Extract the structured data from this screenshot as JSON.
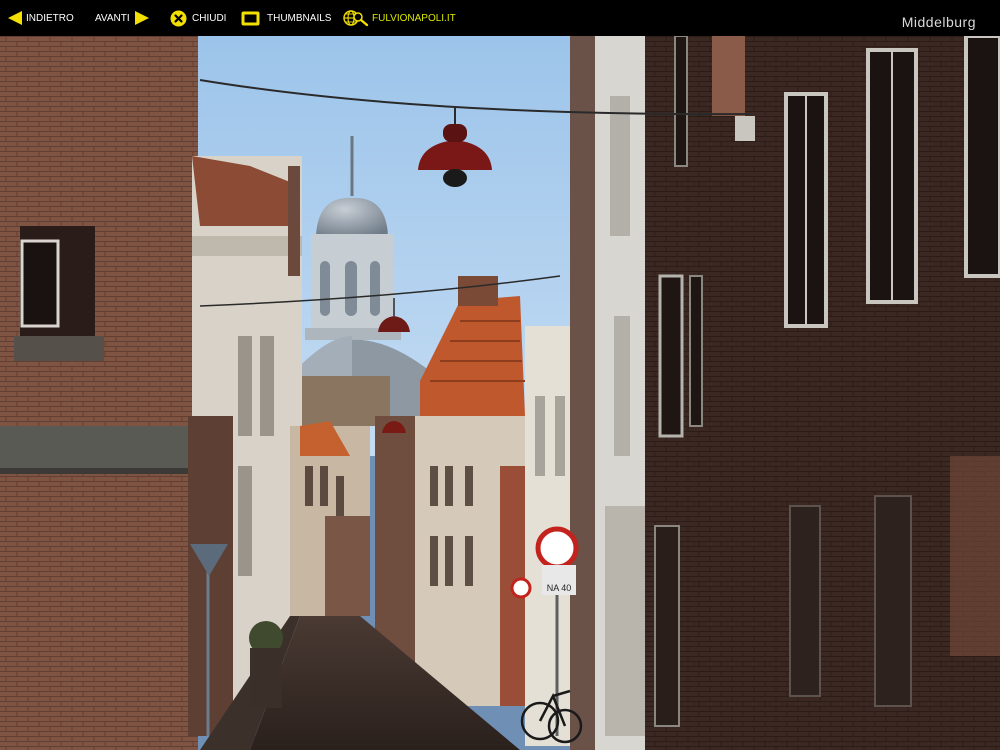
{
  "toolbar": {
    "prev_label": "INDIETRO",
    "next_label": "AVANTI",
    "close_label": "CHIUDI",
    "thumbnails_label": "THUMBNAILS",
    "site_label": "FULVIONAPOLI.IT"
  },
  "page": {
    "title": "Middelburg"
  },
  "photo": {
    "sign_text_line1": "NA 40",
    "colors": {
      "sky": "#a9cdf0",
      "brick_dark": "#3a2822",
      "brick_light": "#8a5b49",
      "roof": "#b9552f"
    }
  },
  "colors": {
    "accent_yellow": "#f3e000",
    "site_link": "#d8e600",
    "title_gray": "#d9d9d9"
  },
  "icons": {
    "prev": "arrow-left-icon",
    "next": "arrow-right-icon",
    "close": "close-circle-icon",
    "thumbnails": "thumbnails-icon",
    "site": "globe-search-icon"
  }
}
